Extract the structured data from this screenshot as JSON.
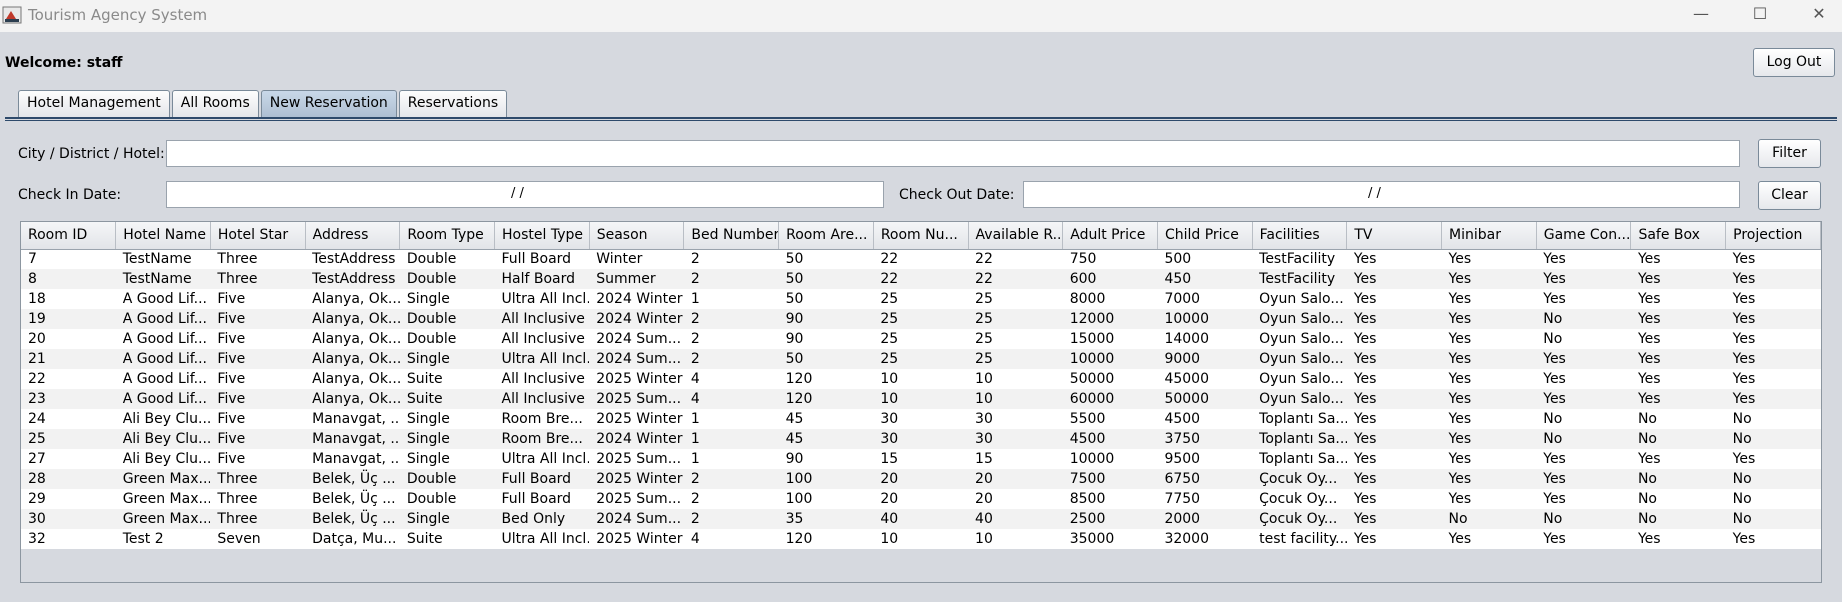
{
  "window": {
    "title": "Tourism Agency System",
    "minimize": "—",
    "maximize": "☐",
    "close": "✕"
  },
  "header": {
    "welcome": "Welcome: staff",
    "logout_label": "Log Out"
  },
  "tabs": [
    {
      "label": "Hotel Management",
      "active": false
    },
    {
      "label": "All Rooms",
      "active": false
    },
    {
      "label": "New Reservation",
      "active": true
    },
    {
      "label": "Reservations",
      "active": false
    }
  ],
  "filter": {
    "search_label": "City / District / Hotel:",
    "search_value": "",
    "checkin_label": "Check In Date:",
    "checkin_value": "/  /",
    "checkout_label": "Check Out Date:",
    "checkout_value": "/  /",
    "filter_label": "Filter",
    "clear_label": "Clear"
  },
  "table": {
    "columns": [
      "Room ID",
      "Hotel Name",
      "Hotel Star",
      "Address",
      "Room Type",
      "Hostel Type",
      "Season",
      "Bed Number",
      "Room Are...",
      "Room Nu...",
      "Available R...",
      "Adult Price",
      "Child Price",
      "Facilities",
      "TV",
      "Minibar",
      "Game Con...",
      "Safe Box",
      "Projection"
    ],
    "rows": [
      [
        "7",
        "TestName",
        "Three",
        "TestAddress",
        "Double",
        "Full Board",
        "Winter",
        "2",
        "50",
        "22",
        "22",
        "750",
        "500",
        "TestFacility",
        "Yes",
        "Yes",
        "Yes",
        "Yes",
        "Yes"
      ],
      [
        "8",
        "TestName",
        "Three",
        "TestAddress",
        "Double",
        "Half Board",
        "Summer",
        "2",
        "50",
        "22",
        "22",
        "600",
        "450",
        "TestFacility",
        "Yes",
        "Yes",
        "Yes",
        "Yes",
        "Yes"
      ],
      [
        "18",
        "A Good Lif...",
        "Five",
        "Alanya, Ok...",
        "Single",
        "Ultra All Incl...",
        "2024 Winter",
        "1",
        "50",
        "25",
        "25",
        "8000",
        "7000",
        "Oyun Salo...",
        "Yes",
        "Yes",
        "Yes",
        "Yes",
        "Yes"
      ],
      [
        "19",
        "A Good Lif...",
        "Five",
        "Alanya, Ok...",
        "Double",
        "All Inclusive",
        "2024 Winter",
        "2",
        "90",
        "25",
        "25",
        "12000",
        "10000",
        "Oyun Salo...",
        "Yes",
        "Yes",
        "No",
        "Yes",
        "Yes"
      ],
      [
        "20",
        "A Good Lif...",
        "Five",
        "Alanya, Ok...",
        "Double",
        "All Inclusive",
        "2024 Sum...",
        "2",
        "90",
        "25",
        "25",
        "15000",
        "14000",
        "Oyun Salo...",
        "Yes",
        "Yes",
        "No",
        "Yes",
        "Yes"
      ],
      [
        "21",
        "A Good Lif...",
        "Five",
        "Alanya, Ok...",
        "Single",
        "Ultra All Incl...",
        "2024 Sum...",
        "2",
        "50",
        "25",
        "25",
        "10000",
        "9000",
        "Oyun Salo...",
        "Yes",
        "Yes",
        "Yes",
        "Yes",
        "Yes"
      ],
      [
        "22",
        "A Good Lif...",
        "Five",
        "Alanya, Ok...",
        "Suite",
        "All Inclusive",
        "2025 Winter",
        "4",
        "120",
        "10",
        "10",
        "50000",
        "45000",
        "Oyun Salo...",
        "Yes",
        "Yes",
        "Yes",
        "Yes",
        "Yes"
      ],
      [
        "23",
        "A Good Lif...",
        "Five",
        "Alanya, Ok...",
        "Suite",
        "All Inclusive",
        "2025 Sum...",
        "4",
        "120",
        "10",
        "10",
        "60000",
        "50000",
        "Oyun Salo...",
        "Yes",
        "Yes",
        "Yes",
        "Yes",
        "Yes"
      ],
      [
        "24",
        "Ali Bey Clu...",
        "Five",
        "Manavgat, ...",
        "Single",
        "Room Bre...",
        "2025 Winter",
        "1",
        "45",
        "30",
        "30",
        "5500",
        "4500",
        "Toplantı Sa...",
        "Yes",
        "Yes",
        "No",
        "No",
        "No"
      ],
      [
        "25",
        "Ali Bey Clu...",
        "Five",
        "Manavgat, ...",
        "Single",
        "Room Bre...",
        "2024 Winter",
        "1",
        "45",
        "30",
        "30",
        "4500",
        "3750",
        "Toplantı Sa...",
        "Yes",
        "Yes",
        "No",
        "No",
        "No"
      ],
      [
        "27",
        "Ali Bey Clu...",
        "Five",
        "Manavgat, ...",
        "Single",
        "Ultra All Incl...",
        "2025 Sum...",
        "1",
        "90",
        "15",
        "15",
        "10000",
        "9500",
        "Toplantı Sa...",
        "Yes",
        "Yes",
        "Yes",
        "Yes",
        "Yes"
      ],
      [
        "28",
        "Green Max...",
        "Three",
        "Belek, Üç ...",
        "Double",
        "Full Board",
        "2025 Winter",
        "2",
        "100",
        "20",
        "20",
        "7500",
        "6750",
        "Çocuk Oy...",
        "Yes",
        "Yes",
        "Yes",
        "No",
        "No"
      ],
      [
        "29",
        "Green Max...",
        "Three",
        "Belek, Üç ...",
        "Double",
        "Full Board",
        "2025 Sum...",
        "2",
        "100",
        "20",
        "20",
        "8500",
        "7750",
        "Çocuk Oy...",
        "Yes",
        "Yes",
        "Yes",
        "No",
        "No"
      ],
      [
        "30",
        "Green Max...",
        "Three",
        "Belek, Üç ...",
        "Single",
        "Bed Only",
        "2024 Sum...",
        "2",
        "35",
        "40",
        "40",
        "2500",
        "2000",
        "Çocuk Oy...",
        "Yes",
        "No",
        "No",
        "No",
        "No"
      ],
      [
        "32",
        "Test 2",
        "Seven",
        "Datça, Mu...",
        "Suite",
        "Ultra All Incl...",
        "2025 Winter",
        "4",
        "120",
        "10",
        "10",
        "35000",
        "32000",
        "test facility...",
        "Yes",
        "Yes",
        "Yes",
        "Yes",
        "Yes"
      ]
    ]
  }
}
